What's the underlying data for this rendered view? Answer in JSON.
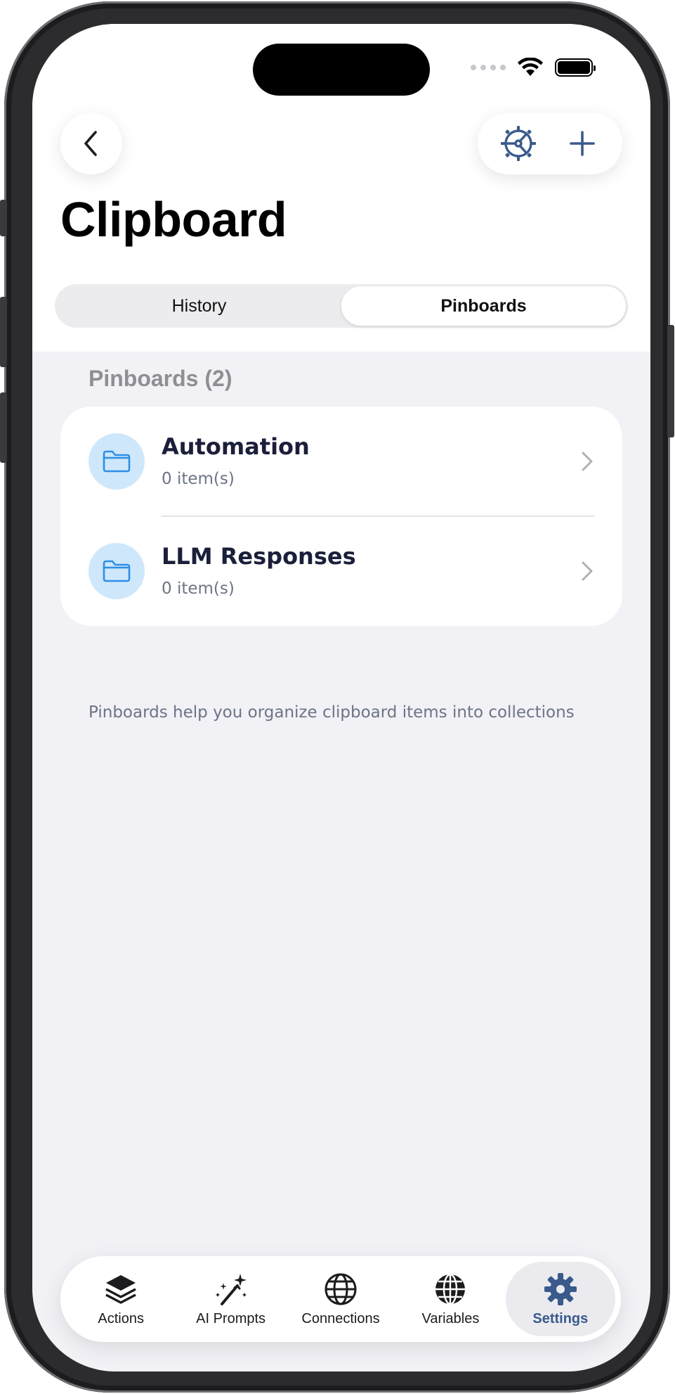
{
  "header": {
    "title": "Clipboard",
    "back_icon": "chevron-left-icon",
    "settings_icon": "steering-wheel-icon",
    "add_icon": "plus-icon"
  },
  "segmented": {
    "history": "History",
    "pinboards": "Pinboards",
    "selected": "Pinboards"
  },
  "pinboards": {
    "section_title": "Pinboards (2)",
    "items": [
      {
        "name": "Automation",
        "count": "0 item(s)"
      },
      {
        "name": "LLM Responses",
        "count": "0 item(s)"
      }
    ],
    "helper_text": "Pinboards help you organize clipboard items into collections"
  },
  "tabbar": {
    "selected": "Settings",
    "items": [
      {
        "label": "Actions",
        "icon": "stack-icon"
      },
      {
        "label": "AI Prompts",
        "icon": "magic-wand-icon"
      },
      {
        "label": "Connections",
        "icon": "globe-icon"
      },
      {
        "label": "Variables",
        "icon": "globe-grid-icon"
      },
      {
        "label": "Settings",
        "icon": "gear-icon"
      }
    ]
  },
  "colors": {
    "accent": "#3a5a8c",
    "folder_bg": "#cfe7fb",
    "folder_icon": "#2d8fe6",
    "screen_bg": "#f1f1f6"
  }
}
